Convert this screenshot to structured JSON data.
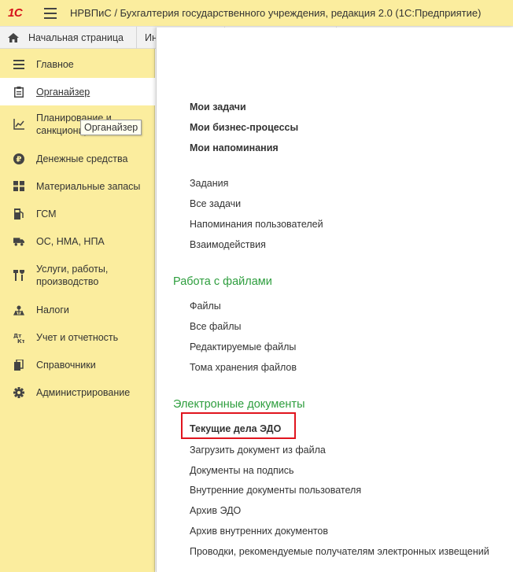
{
  "window": {
    "logo_text": "1С",
    "title": "НРВПиС / Бухгалтерия государственного учреждения, редакция 2.0  (1С:Предприятие)"
  },
  "tabs": [
    {
      "label": "Начальная страница"
    },
    {
      "label": "Ин"
    },
    {
      "label": ""
    },
    {
      "label": ""
    }
  ],
  "sidebar": {
    "items": [
      {
        "label": "Главное",
        "icon": "menu-lines-icon"
      },
      {
        "label": "Органайзер",
        "icon": "clipboard-icon",
        "active": true
      },
      {
        "label": "Планирование и санкционирование",
        "line1": "Планирование и",
        "line2": "санкционир",
        "icon": "chart-icon"
      },
      {
        "label": "Денежные средства",
        "icon": "ruble-coin-icon"
      },
      {
        "label": "Материальные запасы",
        "icon": "grid-icon"
      },
      {
        "label": "ГСМ",
        "icon": "fuel-icon"
      },
      {
        "label": "ОС, НМА, НПА",
        "icon": "truck-icon"
      },
      {
        "label": "Услуги, работы, производство",
        "line1": "Услуги, работы,",
        "line2": "производство",
        "icon": "tools-icon"
      },
      {
        "label": "Налоги",
        "icon": "taxes-icon"
      },
      {
        "label": "Учет и отчетность",
        "icon": "debit-credit-icon"
      },
      {
        "label": "Справочники",
        "icon": "books-icon"
      },
      {
        "label": "Администрирование",
        "icon": "gear-icon"
      }
    ],
    "tooltip": "Органайзер"
  },
  "panel": {
    "tasks": [
      "Мои задачи",
      "Мои бизнес-процессы",
      "Мои напоминания"
    ],
    "task_links": [
      "Задания",
      "Все задачи",
      "Напоминания пользователей",
      "Взаимодействия"
    ],
    "files_section": {
      "title": "Работа с файлами",
      "links": [
        "Файлы",
        "Все файлы",
        "Редактируемые файлы",
        "Тома хранения файлов"
      ]
    },
    "edo_section": {
      "title": "Электронные документы",
      "highlighted": "Текущие дела ЭДО",
      "links": [
        "Загрузить документ из файла",
        "Документы на подпись",
        "Внутренние документы пользователя",
        "Архив ЭДО",
        "Архив внутренних документов",
        "Проводки, рекомендуемые получателям электронных извещений"
      ]
    }
  },
  "colors": {
    "sidebar_bg": "#fbed9e",
    "section_title": "#2e9e3e",
    "highlight_border": "#e0141e",
    "logo": "#d6131b"
  }
}
